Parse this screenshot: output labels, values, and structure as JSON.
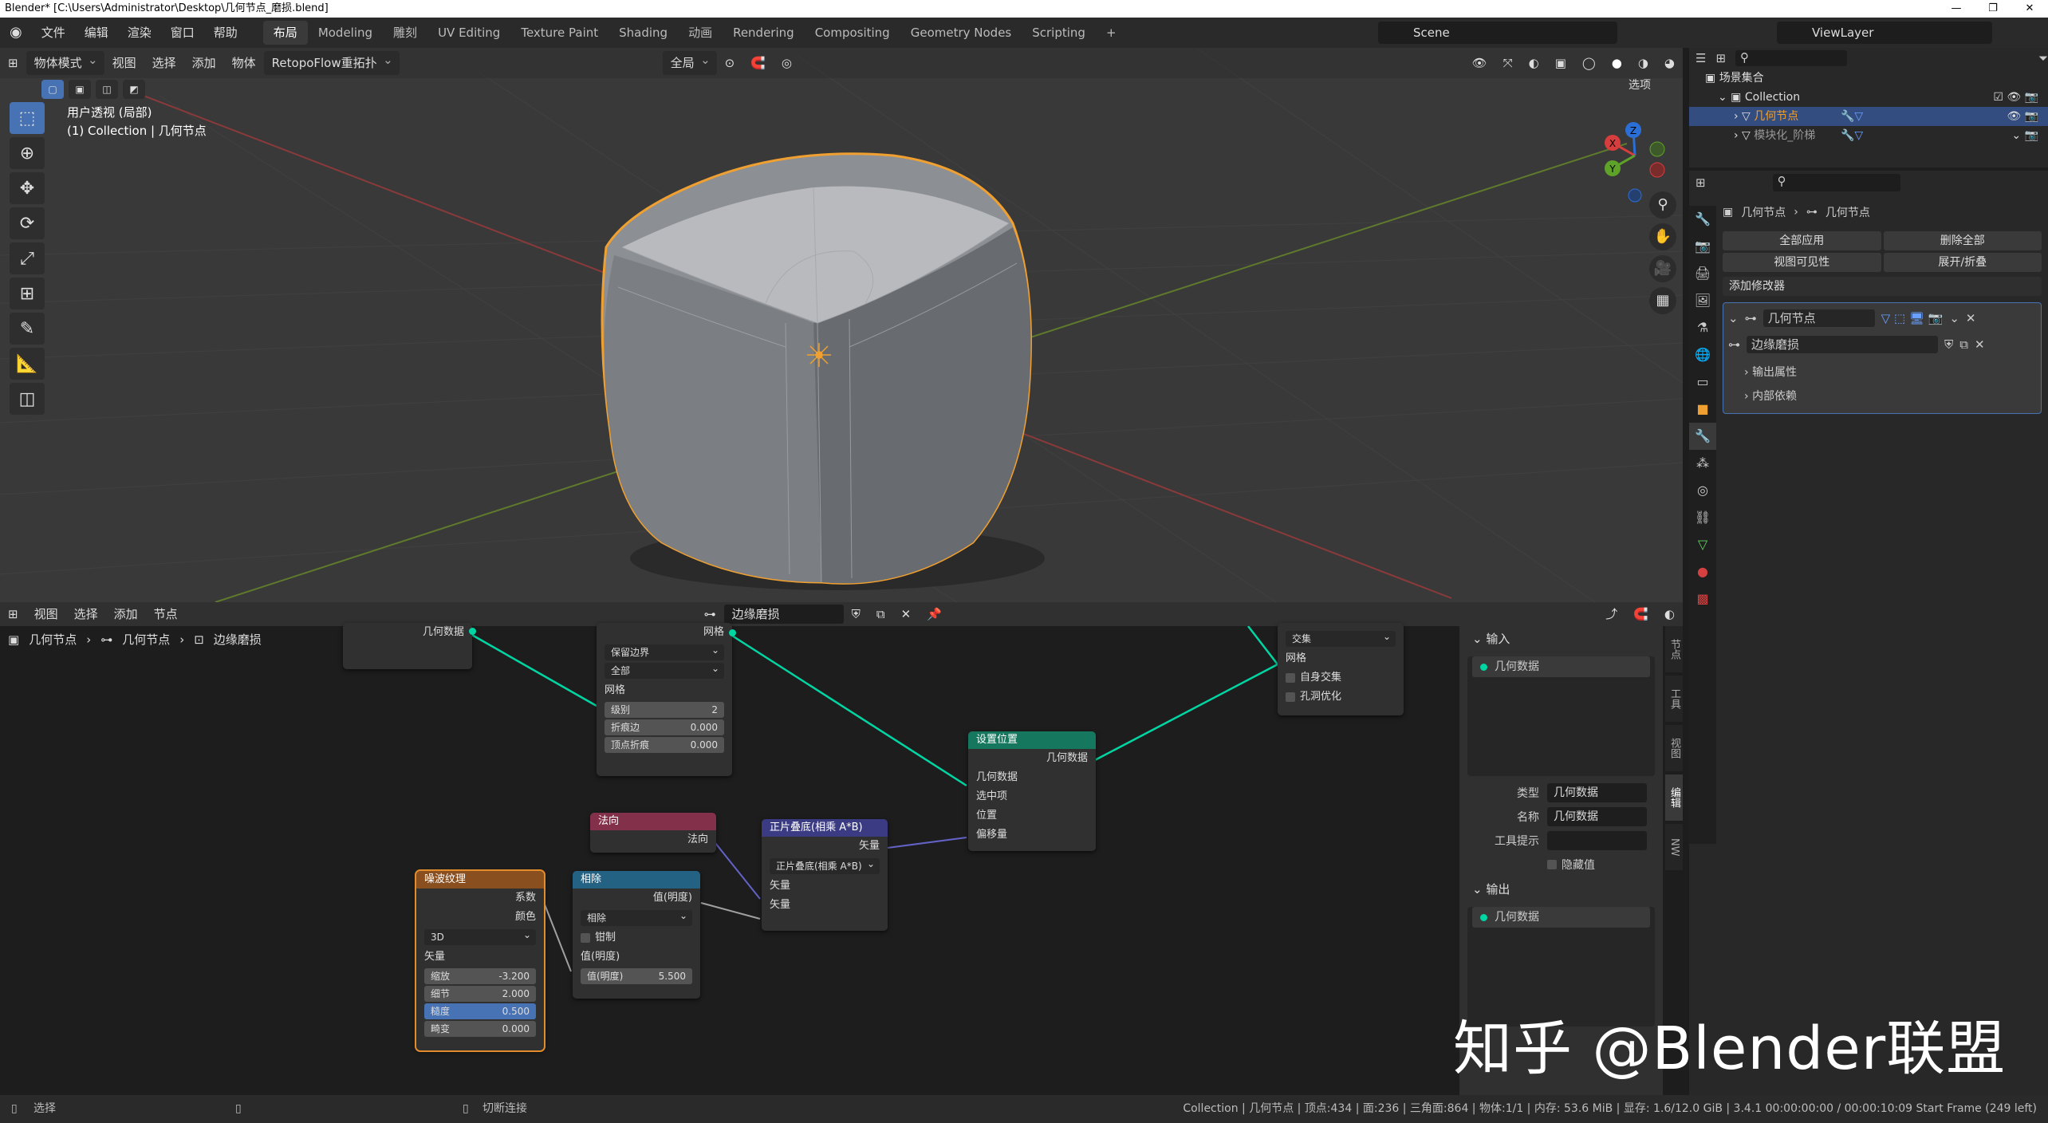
{
  "window": {
    "title": "Blender* [C:\\Users\\Administrator\\Desktop\\几何节点_磨损.blend]"
  },
  "menu": {
    "items": [
      "文件",
      "编辑",
      "渲染",
      "窗口",
      "帮助"
    ]
  },
  "workspaces": [
    "布局",
    "Modeling",
    "雕刻",
    "UV Editing",
    "Texture Paint",
    "Shading",
    "动画",
    "Rendering",
    "Compositing",
    "Geometry Nodes",
    "Scripting"
  ],
  "scene": {
    "name": "Scene",
    "view_layer": "ViewLayer"
  },
  "viewport": {
    "mode": "物体模式",
    "menus": [
      "视图",
      "选择",
      "添加",
      "物体"
    ],
    "addon": "RetopoFlow重拓扑",
    "transform": "全局",
    "options": "选项",
    "info_line1": "用户透视 (局部)",
    "info_line2": "(1) Collection | 几何节点",
    "gizmo_axes": [
      "X",
      "Y",
      "Z"
    ]
  },
  "outliner": {
    "root": "场景集合",
    "collection": "Collection",
    "items": [
      {
        "name": "几何节点",
        "selected": true
      },
      {
        "name": "模块化_阶梯",
        "selected": false
      }
    ]
  },
  "properties": {
    "breadcrumb": [
      "几何节点",
      "几何节点"
    ],
    "apply_all": "全部应用",
    "delete_all": "删除全部",
    "viewport_vis": "视图可见性",
    "expand_collapse": "展开/折叠",
    "add_modifier": "添加修改器",
    "modifier": {
      "name": "几何节点",
      "node_group": "边缘磨损",
      "sub": [
        "输出属性",
        "内部依赖"
      ]
    }
  },
  "node_editor": {
    "menus": [
      "视图",
      "选择",
      "添加",
      "节点"
    ],
    "node_group": "边缘磨损",
    "breadcrumb": [
      "几何节点",
      "几何节点",
      "边缘磨损"
    ],
    "nodes": {
      "group_input": {
        "out": "几何数据"
      },
      "subdiv": {
        "out": "网格",
        "opt1": "保留边界",
        "opt2": "全部",
        "in_mesh": "网格",
        "level_label": "级别",
        "level": "2",
        "crease_edge_label": "折痕边",
        "crease_edge": "0.000",
        "crease_vert_label": "顶点折痕",
        "crease_vert": "0.000"
      },
      "boolean": {
        "op": "交集",
        "in_mesh": "网格",
        "self_intersect": "自身交集",
        "hole_tol": "孔洞优化"
      },
      "set_position": {
        "title": "设置位置",
        "out": "几何数据",
        "in_geo": "几何数据",
        "selection": "选中项",
        "position": "位置",
        "offset": "偏移量"
      },
      "normal": {
        "title": "法向",
        "out": "法向"
      },
      "vector_math": {
        "title": "正片叠底(相乘 A*B)",
        "out": "矢量",
        "op": "正片叠底(相乘 A*B)",
        "in1": "矢量",
        "in2": "矢量"
      },
      "noise": {
        "title": "噪波纹理",
        "out_fac": "系数",
        "out_color": "颜色",
        "dims": "3D",
        "in_vec": "矢量",
        "scale_label": "缩放",
        "scale": "-3.200",
        "detail_label": "细节",
        "detail": "2.000",
        "rough_label": "糙度",
        "rough": "0.500",
        "distort_label": "畸变",
        "distort": "0.000"
      },
      "math": {
        "title": "相除",
        "out": "值(明度)",
        "op": "相除",
        "clamp": "钳制",
        "in1": "值(明度)",
        "in2_label": "值(明度)",
        "in2": "5.500"
      }
    }
  },
  "npanel": {
    "inputs_title": "输入",
    "input_item": "几何数据",
    "type_label": "类型",
    "type_value": "几何数据",
    "name_label": "名称",
    "name_value": "几何数据",
    "tooltip_label": "工具提示",
    "hide_value": "隐藏值",
    "outputs_title": "输出",
    "output_item": "几何数据",
    "tabs": [
      "节点",
      "工具",
      "视图",
      "编辑",
      "NW"
    ]
  },
  "status": {
    "left": "选择",
    "mid": "切断连接",
    "right": "Collection | 几何节点 | 顶点:434 | 面:236 | 三角面:864 | 物体:1/1 | 内存: 53.6 MiB | 显存: 1.6/12.0 GiB | 3.4.1  00:00:00:00 / 00:00:10:09  Start Frame (249 left)"
  },
  "watermark": "知乎 @Blender联盟",
  "colors": {
    "accent": "#4772b3",
    "selected_outline": "#e38c2c",
    "geometry_socket": "#00d6a3",
    "vector_socket": "#6363c7"
  }
}
